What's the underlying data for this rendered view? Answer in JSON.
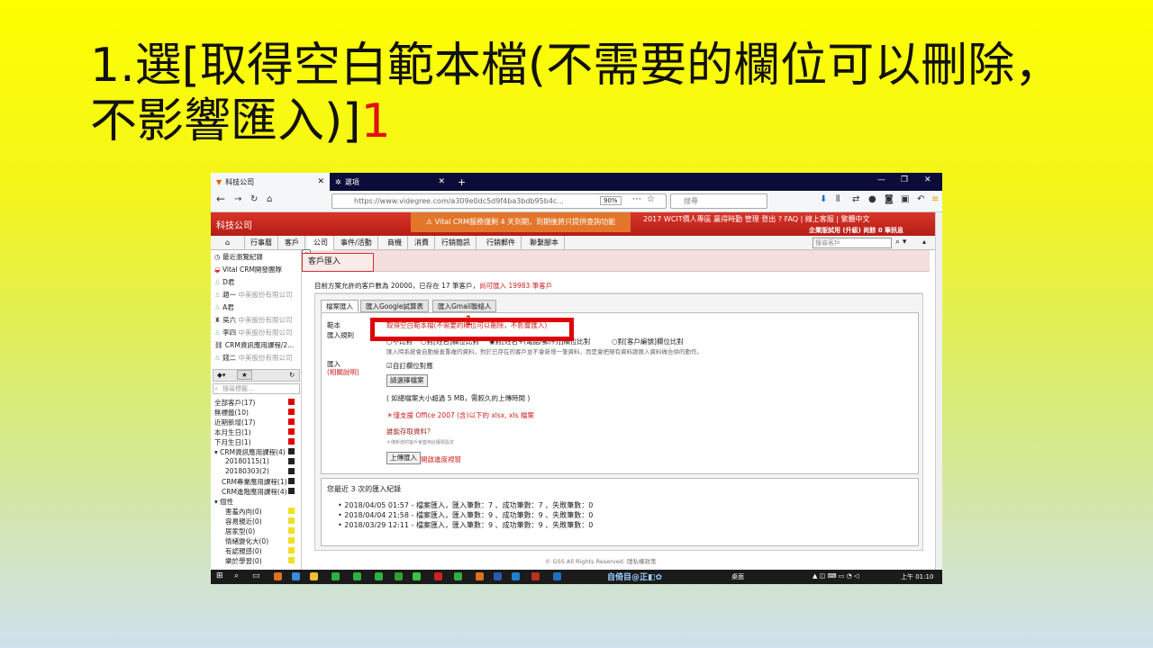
{
  "slide": {
    "title": "1.選[取得空白範本檔(不需要的欄位可以刪除，不影響匯入)]",
    "step_number": "1"
  },
  "browser": {
    "tab1_title": "科技公司",
    "tab2_title": "選項",
    "new_tab": "+",
    "url": "https://www.videgree.com/a309e0dc5d9f4ba3bdb95b4c...",
    "zoom": "90%",
    "search_placeholder": "搜尋"
  },
  "crm": {
    "brand": "科技公司",
    "warning": "Vital CRM服務僅剩 4 天到期，到期後將只提供查詢功能",
    "top_links": "2017 WCIT價人專區  贏得時勤  管理  登出  ? FAQ | 線上客服 | 繁體中文",
    "edition": "企業版試用 (升級)  尚餘 0 筆訊息",
    "menu": [
      "行事曆",
      "客戶",
      "公司",
      "事件/活動",
      "商機",
      "消費",
      "行銷簡訊",
      "行銷郵件",
      "聯繫腳本"
    ],
    "menu_search_placeholder": "搜尋客戶"
  },
  "sidebar": {
    "recent": "最近瀏覽紀錄",
    "items": [
      {
        "name": "Vital CRM開發團隊",
        "company": ""
      },
      {
        "name": "D君",
        "company": ""
      },
      {
        "name": "趙一",
        "company": "中美股份有限公司"
      },
      {
        "name": "A君",
        "company": ""
      },
      {
        "name": "吳六",
        "company": "中美股份有限公司"
      },
      {
        "name": "李四",
        "company": "中美股份有限公司"
      },
      {
        "name": "CRM資訊應用課程/2...",
        "company": ""
      },
      {
        "name": "錢二",
        "company": "中美股份有限公司"
      }
    ],
    "search_placeholder": "搜尋標籤...",
    "filters": [
      {
        "label": "全部客戶(17)",
        "color": "#e00000"
      },
      {
        "label": "無標籤(10)",
        "color": "#e00000"
      },
      {
        "label": "近期新增(17)",
        "color": "#e00000"
      },
      {
        "label": "本月生日(1)",
        "color": "#e00000"
      },
      {
        "label": "下月生日(1)",
        "color": "#e00000"
      },
      {
        "label": "▾ CRM資訊應用課程(4)",
        "color": "#222222"
      },
      {
        "label": "20180115(1)",
        "color": "#222222"
      },
      {
        "label": "20180303(2)",
        "color": "#222222"
      },
      {
        "label": "CRM專業應用課程(1)",
        "color": "#222222"
      },
      {
        "label": "CRM進階應用課程(4)",
        "color": "#222222"
      },
      {
        "label": "▾ 個性",
        "color": ""
      },
      {
        "label": "害羞內向(0)",
        "color": "#f0e020"
      },
      {
        "label": "容易親近(0)",
        "color": "#f0e020"
      },
      {
        "label": "居家型(0)",
        "color": "#f0e020"
      },
      {
        "label": "情緒變化大(0)",
        "color": "#f0e020"
      },
      {
        "label": "有認親感(0)",
        "color": "#f0e020"
      },
      {
        "label": "樂於學習(0)",
        "color": "#f0e020"
      }
    ]
  },
  "main": {
    "page_title": "客戶匯入",
    "quota_text": "目前方案允許的客戶數為 20000，已存在 17 筆客戶，",
    "quota_remaining": "尚可匯入 19983 筆客戶",
    "tabs": [
      "檔案匯入",
      "匯入Google試算表",
      "匯入Gmail聯絡人"
    ],
    "template_label": "範本",
    "template_link": "取得空白範本檔(不需要的欄位可以刪除，不影響匯入)",
    "rule_label": "匯入規則",
    "rules": [
      "不比對",
      "對[姓名]欄位比對",
      "對[姓名+(電話/郵件)]]欄位比對",
      "對[客戶編號]欄位比對"
    ],
    "rule_note": "匯入時系統會自動檢查重複的資料，對於已存在的客戶並不會新增一筆資料，而是會把現有資料跟匯入資料做合併的動作。",
    "import_label": "匯入",
    "import_help": "(相關說明)",
    "auto_match": "自訂欄位對應",
    "choose_file": "請選擇檔案",
    "size_note": "( 如總檔案大小超過 5 MB，需較久的上傳時間 )",
    "format_note": "＊僅支援 Office 2007 (含)以下的 xlsx, xls 檔案",
    "access_question": "誰能存取資料？",
    "access_note": "＊僅新增的客戶會套用此權限設定",
    "upload_button": "上傳匯入",
    "open_progress": "開啟進度視窗",
    "history_title": "您最近 3 次的匯入紀錄",
    "history": [
      "2018/04/05 01:57 - 檔案匯入，匯入筆數：7 、成功筆數：7 、失敗筆數：0",
      "2018/04/04 21:58 - 檔案匯入，匯入筆數：9 、成功筆數：9 、失敗筆數：0",
      "2018/03/29 12:11 - 檔案匯入，匯入筆數：9 、成功筆數：9 、失敗筆數：0"
    ],
    "footer": "© GSS All Rights Reserved. 隱私權政策"
  },
  "taskbar": {
    "time": "上午 01:10",
    "desktop": "桌面"
  }
}
